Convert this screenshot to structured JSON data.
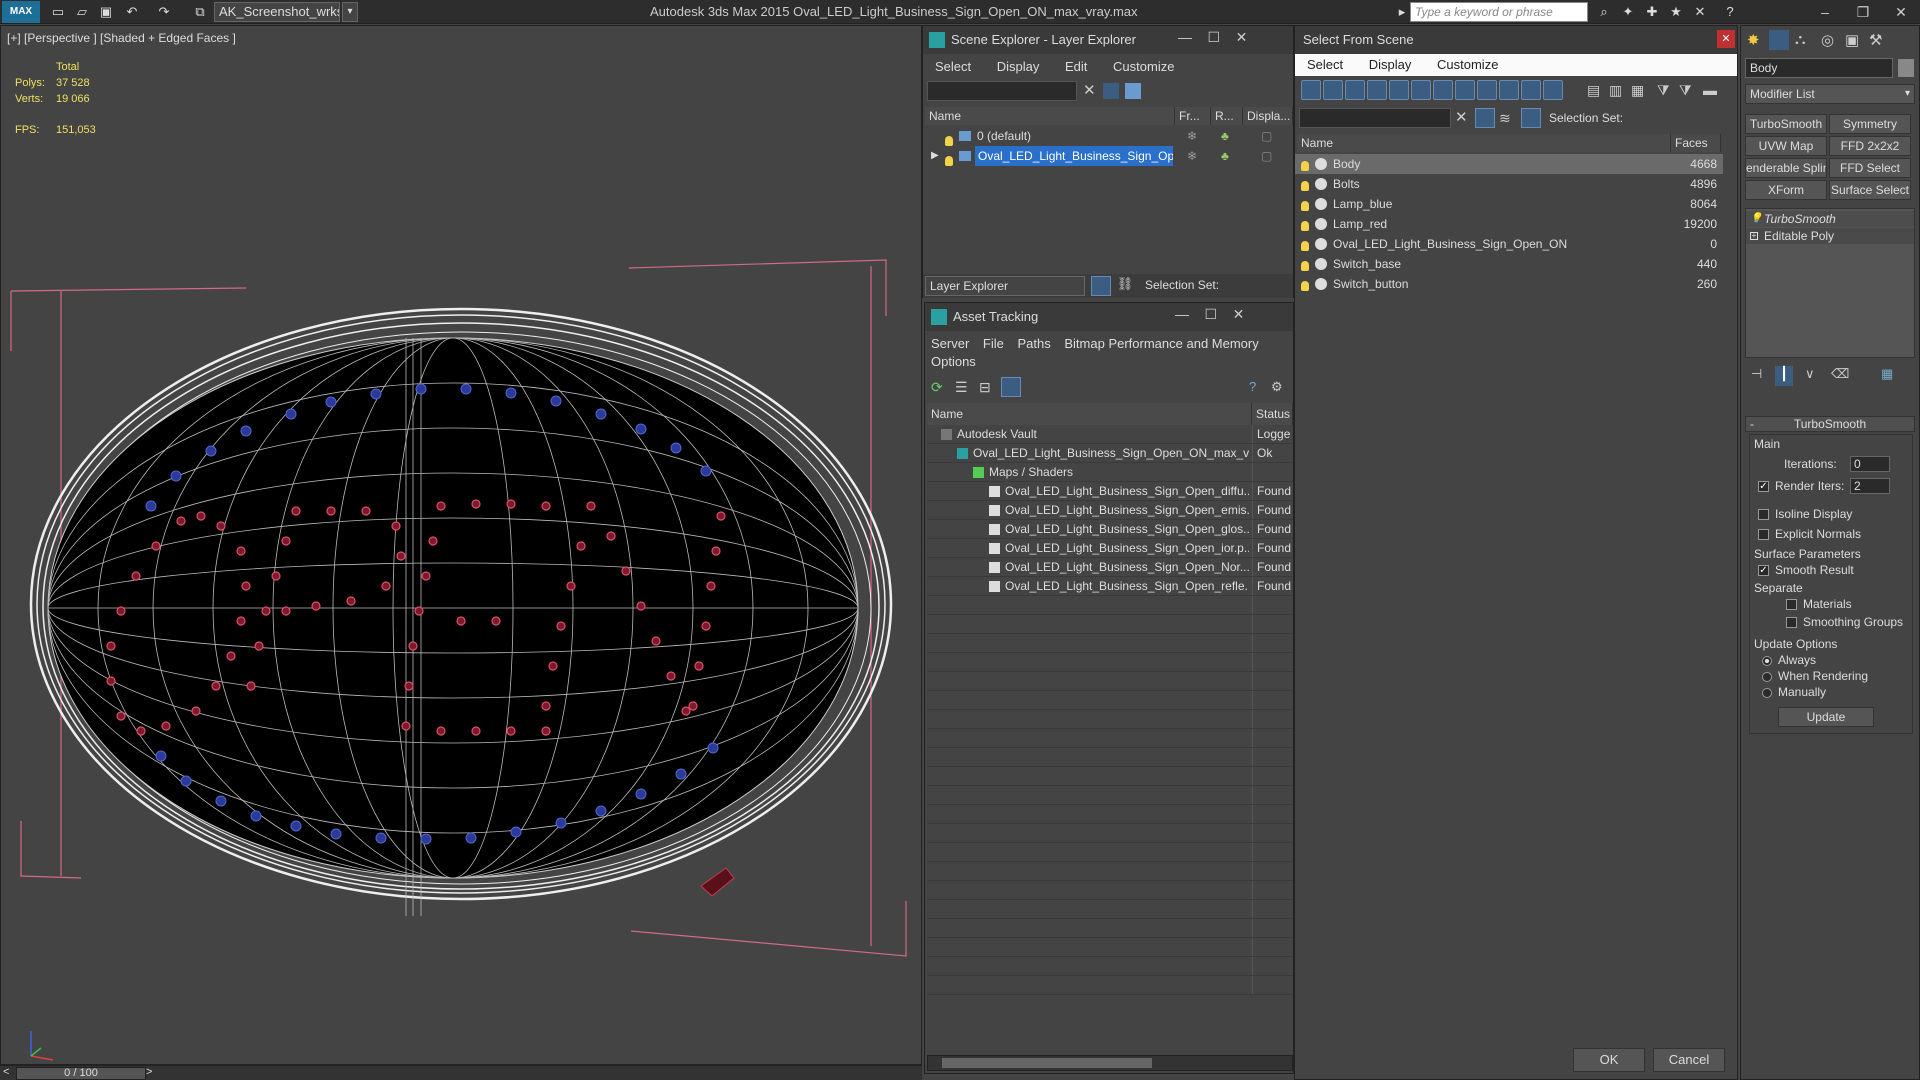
{
  "titlebar": {
    "logo": "MAX",
    "workspace": "AK_Screenshot_wrksp",
    "app_title": "Autodesk 3ds Max  2015     Oval_LED_Light_Business_Sign_Open_ON_max_vray.max",
    "search_placeholder": "Type a keyword or phrase"
  },
  "viewport": {
    "label": "[+] [Perspective ] [Shaded + Edged Faces ]",
    "stats": {
      "total_label": "Total",
      "polys_label": "Polys:",
      "polys_value": "37 528",
      "verts_label": "Verts:",
      "verts_value": "19 066",
      "fps_label": "FPS:",
      "fps_value": "151,053"
    }
  },
  "timeslider": {
    "value": "0 / 100",
    "prev": "<",
    "next": ">"
  },
  "scene_explorer": {
    "title": "Scene Explorer - Layer Explorer",
    "menus": [
      "Select",
      "Display",
      "Edit",
      "Customize"
    ],
    "columns": [
      "Name",
      "Fr...",
      "R...",
      "Displa..."
    ],
    "rows": [
      {
        "name": "0 (default)"
      },
      {
        "name": "Oval_LED_Light_Business_Sign_Open..."
      }
    ],
    "footer_dropdown": "Layer Explorer",
    "selection_set_label": "Selection Set:"
  },
  "asset_tracking": {
    "title": "Asset Tracking",
    "menus": [
      "Server",
      "File",
      "Paths",
      "Bitmap Performance and Memory"
    ],
    "menu2": "Options",
    "columns": [
      "Name",
      "Status"
    ],
    "rows": [
      {
        "name": "Autodesk Vault",
        "status": "Logge",
        "indent": 0
      },
      {
        "name": "Oval_LED_Light_Business_Sign_Open_ON_max_v...",
        "status": "Ok",
        "indent": 1
      },
      {
        "name": "Maps / Shaders",
        "status": "",
        "indent": 2
      },
      {
        "name": "Oval_LED_Light_Business_Sign_Open_diffu...",
        "status": "Found",
        "indent": 3
      },
      {
        "name": "Oval_LED_Light_Business_Sign_Open_emis...",
        "status": "Found",
        "indent": 3
      },
      {
        "name": "Oval_LED_Light_Business_Sign_Open_glos...",
        "status": "Found",
        "indent": 3
      },
      {
        "name": "Oval_LED_Light_Business_Sign_Open_ior.p...",
        "status": "Found",
        "indent": 3
      },
      {
        "name": "Oval_LED_Light_Business_Sign_Open_Nor...",
        "status": "Found",
        "indent": 3
      },
      {
        "name": "Oval_LED_Light_Business_Sign_Open_refle...",
        "status": "Found",
        "indent": 3
      }
    ]
  },
  "select_from_scene": {
    "title": "Select From Scene",
    "menus": [
      "Select",
      "Display",
      "Customize"
    ],
    "selection_set_label": "Selection Set:",
    "columns": [
      "Name",
      "Faces"
    ],
    "rows": [
      {
        "name": "Body",
        "faces": "4668",
        "selected": true
      },
      {
        "name": "Bolts",
        "faces": "4896"
      },
      {
        "name": "Lamp_blue",
        "faces": "8064"
      },
      {
        "name": "Lamp_red",
        "faces": "19200"
      },
      {
        "name": "Oval_LED_Light_Business_Sign_Open_ON",
        "faces": "0"
      },
      {
        "name": "Switch_base",
        "faces": "440"
      },
      {
        "name": "Switch_button",
        "faces": "260"
      }
    ],
    "ok": "OK",
    "cancel": "Cancel"
  },
  "command_panel": {
    "object_name": "Body",
    "modifier_list": "Modifier List",
    "mod_buttons": [
      "TurboSmooth",
      "Symmetry",
      "UVW Map",
      "FFD 2x2x2",
      "enderable Splin",
      "FFD Select",
      "XForm",
      "Surface Select"
    ],
    "stack": [
      "TurboSmooth",
      "Editable Poly"
    ],
    "rollout_title": "TurboSmooth",
    "main_label": "Main",
    "iterations_label": "Iterations:",
    "iterations_value": "0",
    "render_iters_label": "Render Iters:",
    "render_iters_value": "2",
    "isoline": "Isoline Display",
    "explicit_normals": "Explicit Normals",
    "surface_params": "Surface Parameters",
    "smooth_result": "Smooth Result",
    "separate": "Separate",
    "materials": "Materials",
    "smoothing_groups": "Smoothing Groups",
    "update_options": "Update Options",
    "always": "Always",
    "when_rendering": "When Rendering",
    "manually": "Manually",
    "update": "Update"
  }
}
